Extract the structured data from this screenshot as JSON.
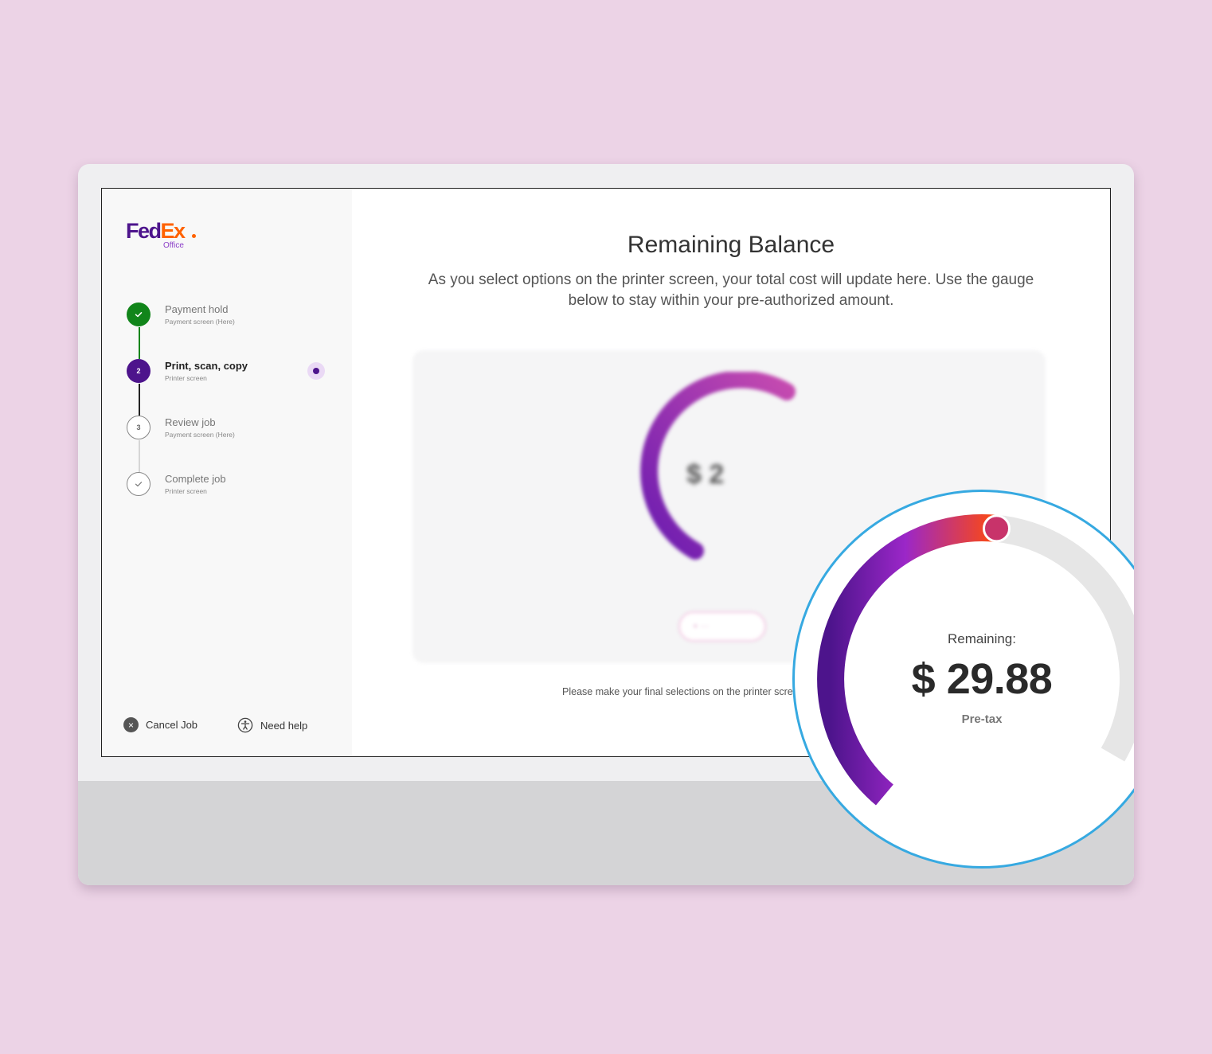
{
  "brand": {
    "logo_main_a": "Fed",
    "logo_main_b": "Ex",
    "logo_sub": "Office"
  },
  "steps": [
    {
      "number": "",
      "title": "Payment hold",
      "subtitle": "Payment screen (Here)",
      "status": "complete"
    },
    {
      "number": "2",
      "title": "Print, scan, copy",
      "subtitle": "Printer screen",
      "status": "active"
    },
    {
      "number": "3",
      "title": "Review job",
      "subtitle": "Payment screen (Here)",
      "status": "pending"
    },
    {
      "number": "",
      "title": "Complete job",
      "subtitle": "Printer screen",
      "status": "pending-check"
    }
  ],
  "footer": {
    "cancel_label": "Cancel Job",
    "help_label": "Need help"
  },
  "main": {
    "title": "Remaining Balance",
    "description": "As you select options on the printer screen, your total cost will update here. Use the gauge below to stay within your pre-authorized amount.",
    "final_note": "Please make your final selections on the printer screen t"
  },
  "gauge": {
    "label": "Remaining:",
    "amount": "$ 29.88",
    "tax_note": "Pre-tax",
    "blurred_amount": "$ 2",
    "fill_fraction": 0.56,
    "colors": {
      "start": "#4d148c",
      "middle": "#9b27c8",
      "end": "#ff4a0c",
      "handle": "#c8336a",
      "track": "#e6e6e6",
      "lens_border": "#36a9e1"
    }
  },
  "colors": {
    "background": "#ecd3e6",
    "complete": "#11851a",
    "active": "#4d148c",
    "fedex_purple": "#4d148c",
    "fedex_orange": "#ff6200"
  }
}
